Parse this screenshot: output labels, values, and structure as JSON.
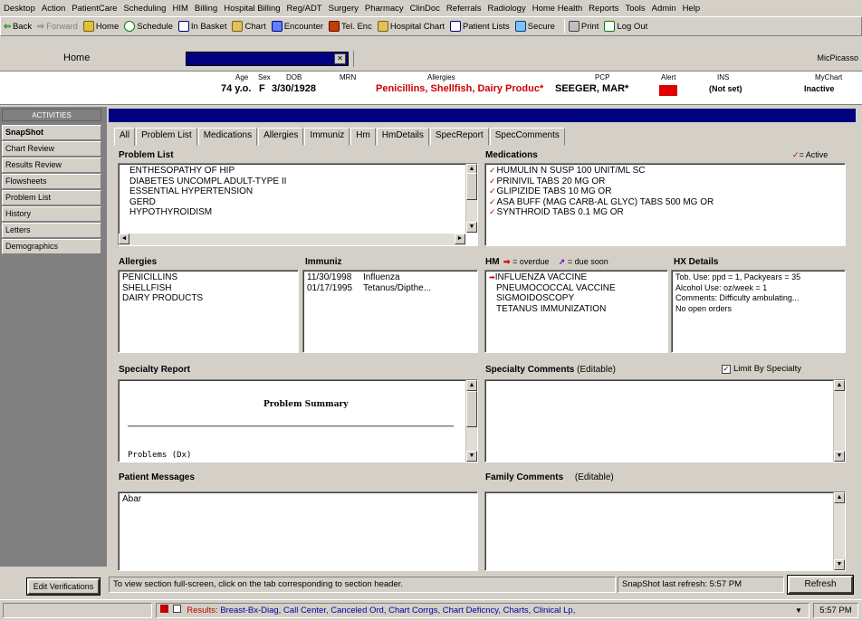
{
  "menu": [
    "Desktop",
    "Action",
    "PatientCare",
    "Scheduling",
    "HIM",
    "Billing",
    "Hospital Billing",
    "Reg/ADT",
    "Surgery",
    "Pharmacy",
    "ClinDoc",
    "Referrals",
    "Radiology",
    "Home Health",
    "Reports",
    "Tools",
    "Admin",
    "Help"
  ],
  "toolbar": {
    "back": "Back",
    "forward": "Forward",
    "home": "Home",
    "schedule": "Schedule",
    "inbasket": "In Basket",
    "chart": "Chart",
    "encounter": "Encounter",
    "tel_enc": "Tel. Enc",
    "hospital_chart": "Hospital Chart",
    "patient_lists": "Patient Lists",
    "secure": "Secure",
    "print": "Print",
    "logout": "Log Out"
  },
  "home_row": {
    "label": "Home",
    "patient_field": "",
    "right_text": "MicPicasso"
  },
  "banner": {
    "age_label": "Age",
    "sex_label": "Sex",
    "dob_label": "DOB",
    "mrn_label": "MRN",
    "allergies_label": "Allergies",
    "pcp_label": "PCP",
    "alert_label": "Alert",
    "ins_label": "INS",
    "mychart_label": "MyChart",
    "age": "74 y.o.",
    "sex": "F",
    "dob": "3/30/1928",
    "mrn": "",
    "allergies": "Penicillins, Shellfish, Dairy Produc*",
    "pcp": "SEEGER, MAR*",
    "alert": "",
    "ins": "(Not set)",
    "mychart": "Inactive"
  },
  "nav": {
    "header": "ACTIVITIES",
    "items": [
      "SnapShot",
      "Chart Review",
      "Results Review",
      "Flowsheets",
      "Problem List",
      "History",
      "Letters",
      "Demographics"
    ],
    "active": "SnapShot",
    "edit_button": "Edit Verifications"
  },
  "title": "",
  "tabs": [
    "All",
    "Problem List",
    "Medications",
    "Allergies",
    "Immuniz",
    "Hm",
    "HmDetails",
    "SpecReport",
    "SpecComments"
  ],
  "problem_list": {
    "header": "Problem List",
    "items": [
      "ENTHESOPATHY OF HIP",
      "DIABETES UNCOMPL ADULT-TYPE II",
      "ESSENTIAL HYPERTENSION",
      "GERD",
      "HYPOTHYROIDISM"
    ]
  },
  "medications": {
    "header": "Medications",
    "active_legend": "= Active",
    "items": [
      "HUMULIN N SUSP 100 UNIT/ML SC",
      "PRINIVIL TABS 20 MG OR",
      "GLIPIZIDE TABS 10 MG OR",
      "ASA BUFF (MAG CARB-AL GLYC) TABS 500 MG OR",
      "SYNTHROID TABS 0.1 MG OR"
    ]
  },
  "allergies": {
    "header": "Allergies",
    "items": [
      "PENICILLINS",
      "SHELLFISH",
      "DAIRY PRODUCTS"
    ]
  },
  "immunizations": {
    "header": "Immuniz",
    "items": [
      {
        "date": "11/30/1998",
        "name": "Influenza"
      },
      {
        "date": "01/17/1995",
        "name": "Tetanus/Dipthe..."
      }
    ]
  },
  "hm": {
    "header": "HM",
    "overdue_legend": "= overdue",
    "due_soon_legend": "= due soon",
    "items": [
      "INFLUENZA VACCINE",
      "PNEUMOCOCCAL VACCINE",
      "SIGMOIDOSCOPY",
      "TETANUS IMMUNIZATION"
    ]
  },
  "hx_details": {
    "header": "HX Details",
    "lines": [
      "Tob. Use: ppd = 1, Packyears = 35",
      "Alcohol Use: oz/week = 1",
      "Comments: Difficulty ambulating...",
      "No open orders"
    ]
  },
  "specialty_report": {
    "header": "Specialty Report",
    "doc_title": "Problem Summary",
    "doc_line": "Problems (Dx)"
  },
  "specialty_comments": {
    "header": "Specialty Comments",
    "editable": "(Editable)",
    "limit_label": "Limit By Specialty"
  },
  "patient_messages": {
    "header": "Patient Messages",
    "text": "Abar"
  },
  "family_comments": {
    "header": "Family Comments",
    "editable": "(Editable)"
  },
  "status": {
    "message": "To view section full-screen, click on the tab corresponding to section header.",
    "snapshot_time": "SnapShot last refresh: 5:57 PM",
    "refresh_button": "Refresh"
  },
  "taskbar": {
    "results_label": "Results",
    "results_text": "Breast-Bx-Diag, Call Center, Canceled Ord, Chart Corrgs, Chart Deficncy, Charts, Clinical Lp,",
    "clock": "5:57 PM"
  }
}
